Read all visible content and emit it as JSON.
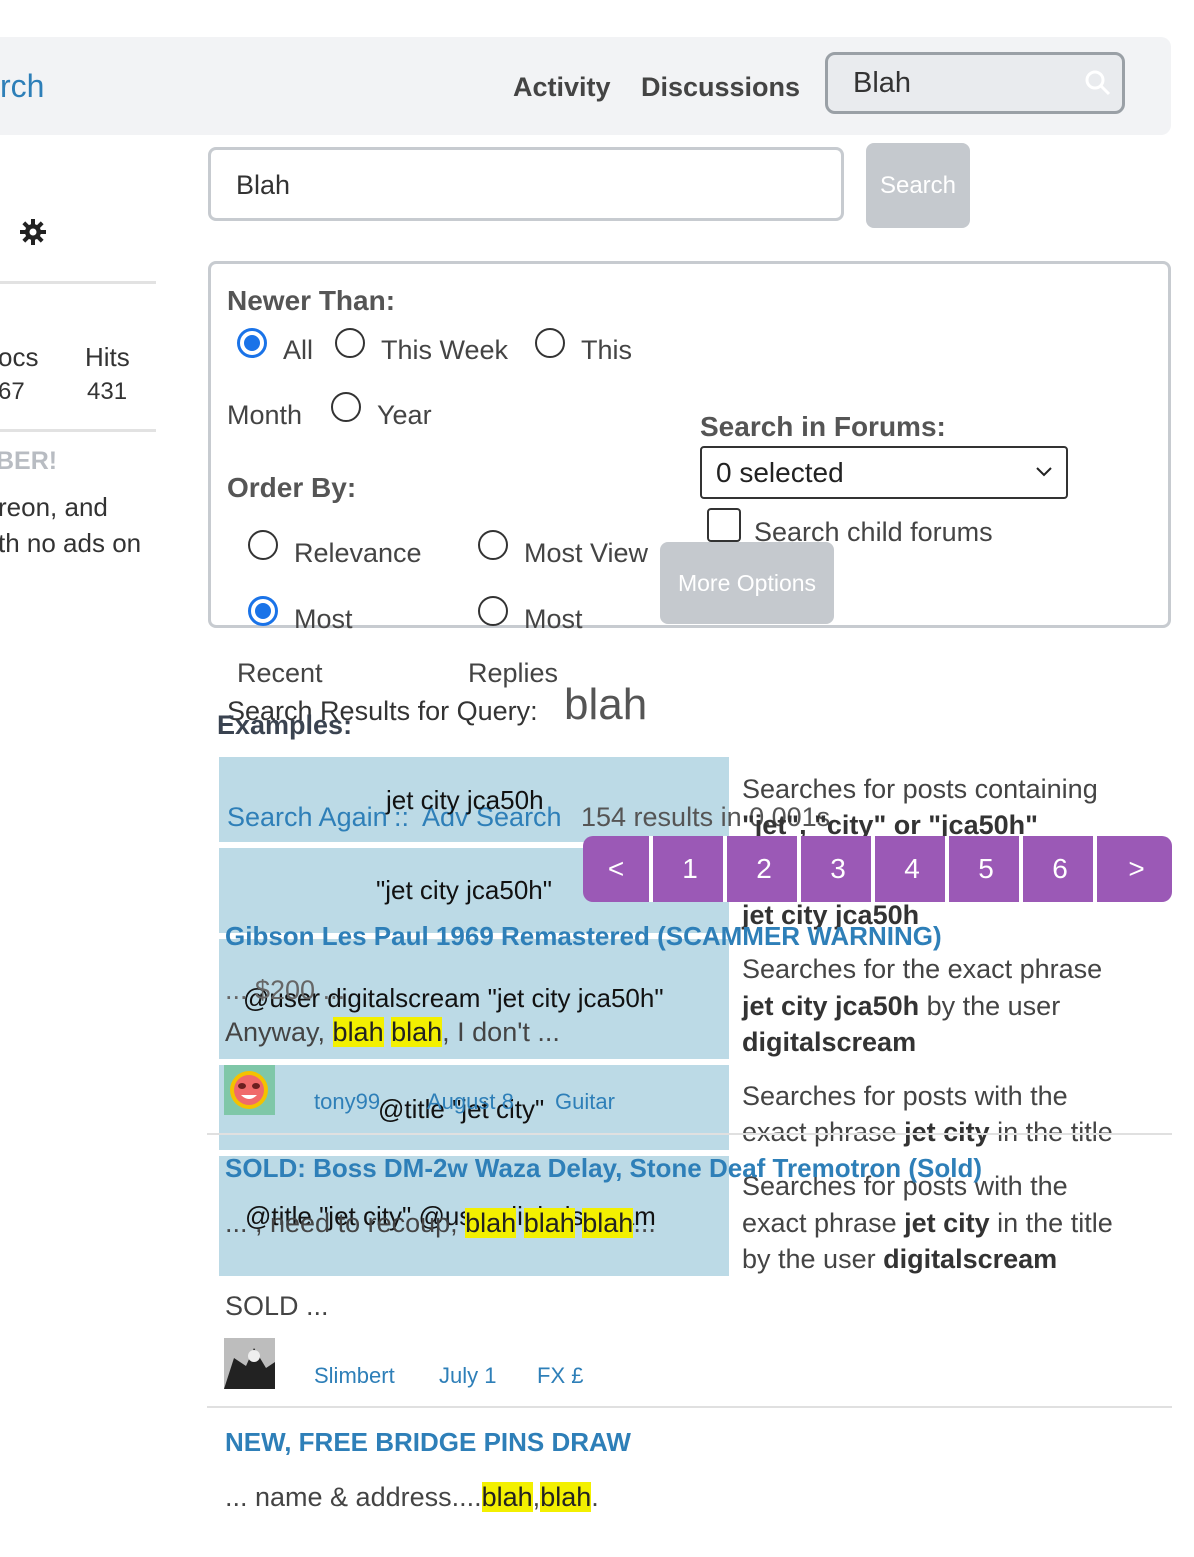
{
  "header": {
    "brand_fragment": "rch",
    "nav": [
      "Activity",
      "Discussions"
    ],
    "search_value": "Blah"
  },
  "sidebar": {
    "stats_labels": [
      "ocs",
      "Hits"
    ],
    "stats_values": [
      "67",
      "431"
    ],
    "promo_heading": "BER!",
    "promo_lines": [
      "reon, and",
      "th no ads on"
    ]
  },
  "search": {
    "query_value": "Blah",
    "button_label": "Search"
  },
  "options": {
    "newer_than_label": "Newer Than:",
    "newer_than": [
      "All",
      "This Week",
      "This",
      "Month",
      "Year"
    ],
    "order_by_label": "Order By:",
    "order_by": [
      "Relevance",
      "Most View",
      "Most",
      "Most",
      "Recent",
      "Replies"
    ],
    "search_in_forums_label": "Search in Forums:",
    "forums_selected": "0 selected",
    "search_child_forums": "Search child forums",
    "more_options": "More Options"
  },
  "results": {
    "results_for_label": "Search Results for Query:",
    "query": "blah",
    "examples_label": "Examples:",
    "search_again": "Search Again",
    "separator": "::",
    "adv_search": "Adv Search",
    "summary": "154 results in 0.001s",
    "pages": [
      "<",
      "1",
      "2",
      "3",
      "4",
      "5",
      "6",
      ">"
    ]
  },
  "tips": [
    {
      "example": "jet city jca50h",
      "desc_plain": "Searches for posts containing",
      "desc_line2": "\"jet\", \"city\" or \"jca50h\""
    },
    {
      "example": "\"jet city jca50h\"",
      "desc_bold": "jet city jca50h"
    },
    {
      "example": "@user digitalscream \"jet city jca50h\"",
      "desc_a": "Searches for the exact phrase",
      "desc_b_bold": "jet city jca50h",
      "desc_b": " by the user",
      "desc_c_bold": "digitalscream"
    },
    {
      "example": "@title \"jet city\"",
      "desc_a": "Searches for posts with the",
      "desc_b": "exact phrase ",
      "desc_b_bold": "jet city",
      "desc_b2": " in the title"
    },
    {
      "example": "@title \"jet city\" @user digitalscream",
      "desc_a": "Searches for posts with the",
      "desc_b": "exact phrase ",
      "desc_b_bold": "jet city",
      "desc_b2": " in the title",
      "desc_c": "by the user ",
      "desc_c_bold": "digitalscream"
    }
  ],
  "posts": [
    {
      "title": "Gibson Les Paul 1969 Remastered (SCAMMER WARNING)",
      "excerpt_pre": "... $200 ...",
      "excerpt_line2_pre": "Anyway, ",
      "hl1": "blah",
      "hl2": "blah",
      "excerpt_post": ", I don't ...",
      "author": "tony99",
      "date": "August 8",
      "forum": "Guitar"
    },
    {
      "title": "SOLD: Boss DM-2w Waza Delay, Stone Deaf Tremotron (Sold)",
      "excerpt_pre": "... , need to recoup, ",
      "hl1": "blah",
      "hl2": "blah",
      "hl3": "blah",
      "excerpt_post": "...",
      "excerpt_line2": "SOLD ...",
      "author": "Slimbert",
      "date": "July 1",
      "forum": "FX £"
    },
    {
      "title": "NEW, FREE BRIDGE PINS DRAW",
      "excerpt_pre": "... name & address....",
      "hl1": "blah",
      "sep": ",",
      "hl2": "blah",
      "excerpt_post": "."
    }
  ],
  "colors": {
    "accent": "#2e7fb8",
    "pager": "#9b59b6",
    "highlight": "#f3f000",
    "tip_bg": "#bcdae6"
  }
}
